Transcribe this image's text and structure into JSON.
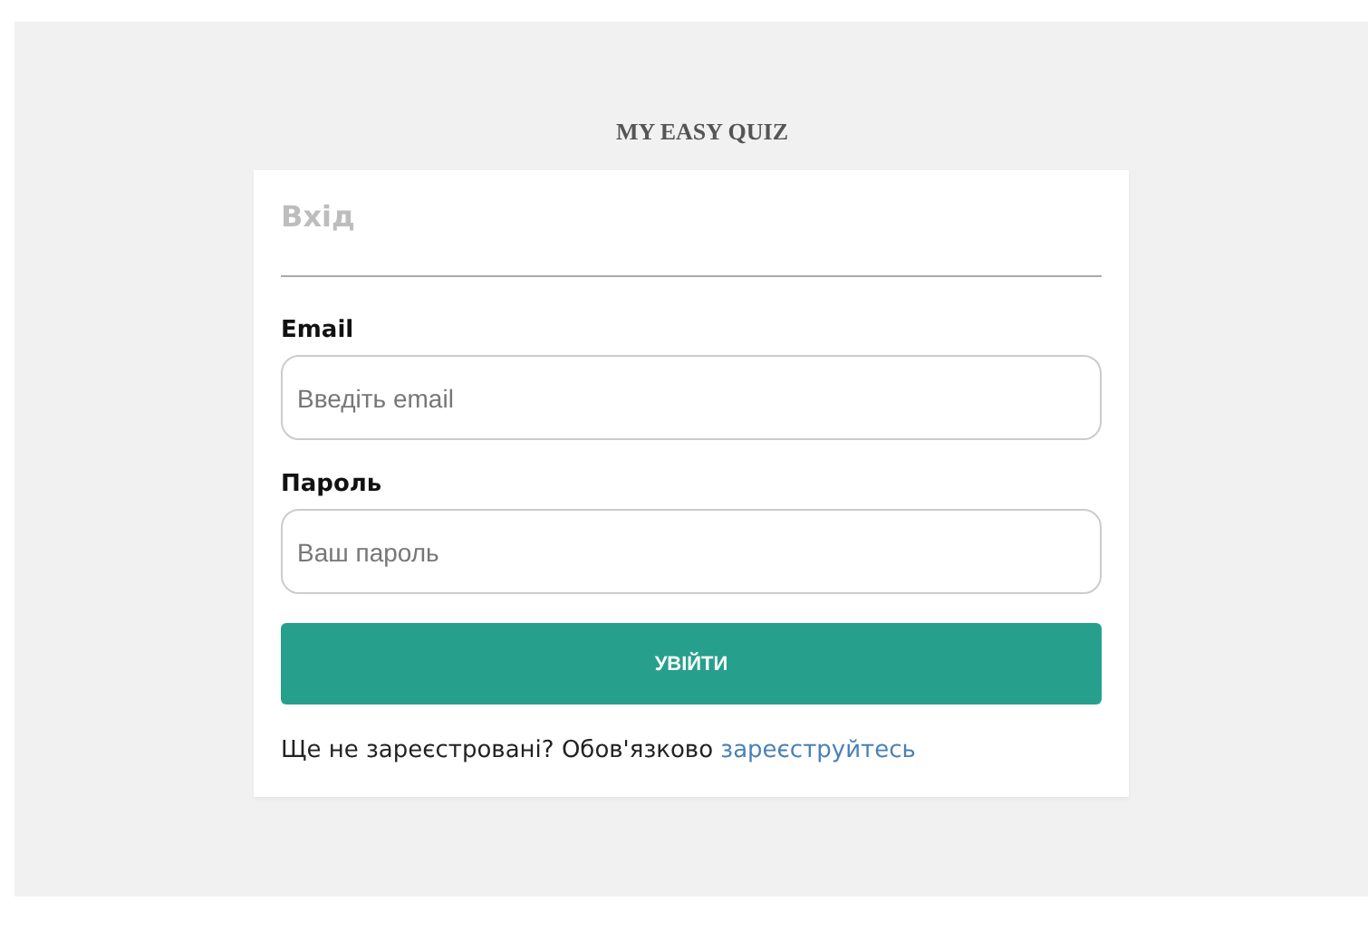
{
  "app_title": "MY EASY QUIZ",
  "form": {
    "heading": "Вхід",
    "fields": [
      {
        "label": "Email",
        "placeholder": "Введіть email"
      },
      {
        "label": "Пароль",
        "placeholder": "Ваш пароль"
      }
    ],
    "submit": "УВІЙТИ",
    "footer": {
      "text": "Ще не зареєстровані? Обов'язково",
      "link": "зареєструйтесь"
    }
  }
}
